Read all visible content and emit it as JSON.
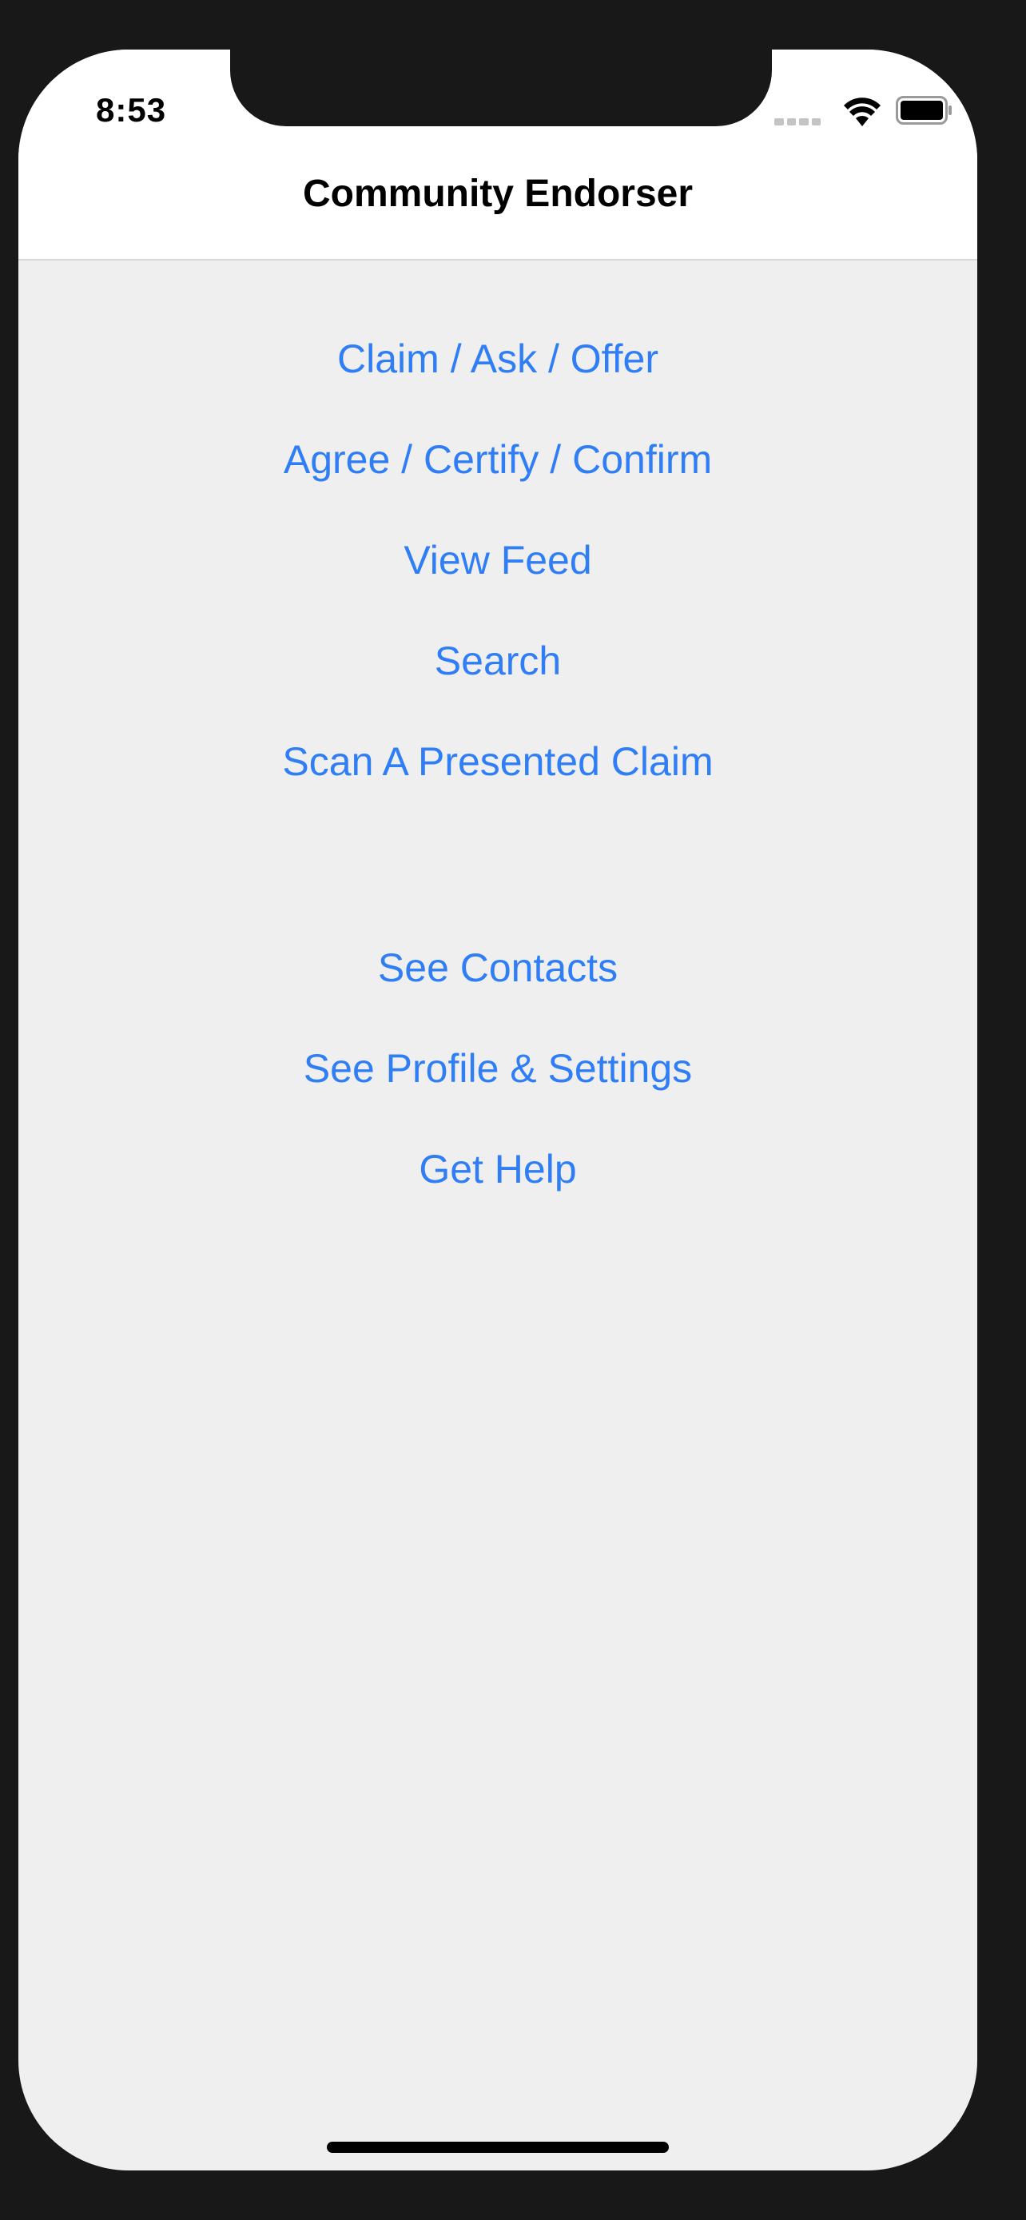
{
  "status_bar": {
    "time": "8:53",
    "icons": [
      "signal-icon",
      "wifi-icon",
      "battery-icon"
    ]
  },
  "nav_bar": {
    "title": "Community Endorser"
  },
  "menu": {
    "items": [
      "Claim / Ask / Offer",
      "Agree / Certify / Confirm",
      "View Feed",
      "Search",
      "Scan A Presented Claim",
      "See Contacts",
      "See Profile & Settings",
      "Get Help"
    ]
  },
  "colors": {
    "link": "#2f7ef6",
    "background": "#efefef",
    "bezel": "#181818"
  }
}
